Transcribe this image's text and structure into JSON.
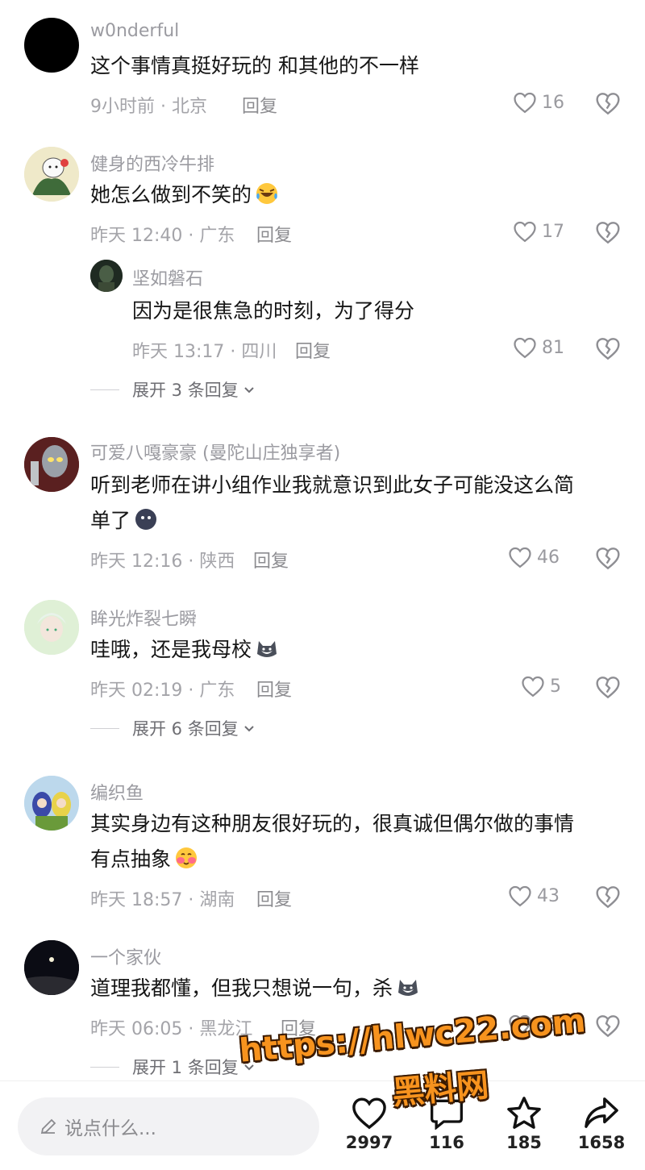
{
  "comments": [
    {
      "user": "w0nderful",
      "text": "这个事情真挺好玩的 和其他的不一样",
      "meta": "9小时前 · 北京",
      "reply": "回复",
      "likes": "16"
    },
    {
      "user": "健身的西冷牛排",
      "text": "她怎么做到不笑的",
      "emoji": "laughing-crying-emoji",
      "meta": "昨天 12:40 · 广东",
      "reply": "回复",
      "likes": "17",
      "sub": {
        "user": "坚如磐石",
        "text": "因为是很焦急的时刻，为了得分",
        "meta": "昨天 13:17 · 四川",
        "reply": "回复",
        "likes": "81"
      },
      "expand": "展开 3 条回复"
    },
    {
      "user": "可爱八嘎豪豪 (曼陀山庄独享者)",
      "text1": "听到老师在讲小组作业我就意识到此女子可能没这么简",
      "text2": "单了",
      "emoji": "dark-blob-emoji",
      "meta": "昨天 12:16 · 陕西",
      "reply": "回复",
      "likes": "46"
    },
    {
      "user": "眸光炸裂七瞬",
      "text": "哇哦，还是我母校",
      "emoji": "husky-emoji",
      "meta": "昨天 02:19 · 广东",
      "reply": "回复",
      "likes": "5",
      "expand": "展开 6 条回复"
    },
    {
      "user": "编织鱼",
      "text1": "其实身边有这种朋友很好玩的，很真诚但偶尔做的事情",
      "text2": "有点抽象",
      "emoji": "blushing-emoji",
      "meta": "昨天 18:57 · 湖南",
      "reply": "回复",
      "likes": "43"
    },
    {
      "user": "一个家伙",
      "text": "道理我都懂，但我只想说一句，杀",
      "emoji": "husky-emoji",
      "meta": "昨天 06:05 · 黑龙江",
      "reply": "回复",
      "likes": "43",
      "expand": "展开 1 条回复"
    }
  ],
  "watermark": {
    "line1": "https://hlwc22.com",
    "line2": "黑料网"
  },
  "bottom": {
    "placeholder": "说点什么...",
    "likes": "2997",
    "comments": "116",
    "favorites": "185",
    "shares": "1658"
  },
  "colors": {
    "watermark": "#f7931e",
    "muted": "#9b9ba1"
  }
}
